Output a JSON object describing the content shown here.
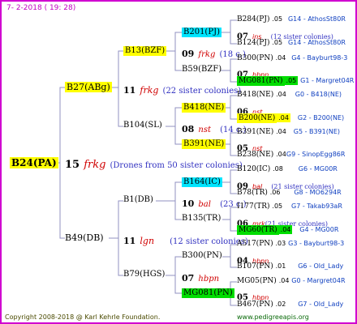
{
  "header": "7- 2-2018 ( 19: 28)",
  "footer": {
    "copyright": "Copyright 2008-2018 @ Karl Kehrle Foundation.",
    "url": "www.pedigreeapis.org"
  },
  "colors": {
    "frame": "#d000d0",
    "yellow": "#ffff00",
    "cyan": "#00e5ff",
    "green": "#00dd00",
    "nick": "#d00000",
    "sisters": "#3030c0",
    "lines": "#9090c0"
  },
  "root": {
    "label": "B24(PA)",
    "gen": "15",
    "nick": "frkg",
    "note": "(Drones from 50 sister colonies)"
  },
  "top": {
    "label": "B27(ABg)",
    "gen": "11",
    "nick": "frkg",
    "note": "(22 sister colonies)",
    "a": {
      "label": "B13(BZF)",
      "gen": "09",
      "nick": "frkg",
      "note": "(18 c.)",
      "p1": {
        "label": "B201(PJ)",
        "gen": "07",
        "nick": "ins",
        "note": "(12 sister colonies)",
        "l1": {
          "name": "B284(PJ)",
          "num": ".05",
          "loc": "G14 - AthosSt80R"
        },
        "l2": {
          "name": "B124(PJ)",
          "num": ".05",
          "loc": "G14 - AthosSt80R"
        }
      },
      "p2": {
        "label": "B59(BZF)",
        "gen": "07",
        "nick": "hbpn",
        "l1": {
          "name": "B300(PN)",
          "num": ".04",
          "loc": "G4 - Bayburt98-3"
        },
        "l2": {
          "name": "MG081(PN)",
          "num": ".05",
          "loc": "G1 - Margret04R"
        }
      }
    },
    "b": {
      "label": "B104(SL)",
      "gen": "08",
      "nick": "nst",
      "note": "(14 c.)",
      "p1": {
        "label": "B418(NE)",
        "gen": "06",
        "nick": "nst",
        "l1": {
          "name": "B418(NE)",
          "num": ".04",
          "loc": "G0 - B418(NE)"
        },
        "l2": {
          "name": "B200(NE)",
          "num": ".04",
          "loc": "G2 - B200(NE)"
        }
      },
      "p2": {
        "label": "B391(NE)",
        "gen": "05",
        "nick": "nst",
        "l1": {
          "name": "B391(NE)",
          "num": ".04",
          "loc": "G5 - B391(NE)"
        },
        "l2": {
          "name": "B238(NE)",
          "num": ".04",
          "loc": "G9 - SinopEgg86R"
        }
      }
    }
  },
  "bottom": {
    "label": "B49(DB)",
    "gen": "11",
    "nick": "lgn",
    "note": "(12 sister colonies)",
    "a": {
      "label": "B1(DB)",
      "gen": "10",
      "nick": "bal",
      "note": "(23 c.)",
      "p1": {
        "label": "B164(IC)",
        "gen": "09",
        "nick": "bal",
        "note": "(21 sister colonies)",
        "l1": {
          "name": "B120(IC)",
          "num": ".08",
          "loc": "G6 - MG00R"
        },
        "l2": {
          "name": "B78(TR)",
          "num": ".06",
          "loc": "G8 - MO6294R"
        }
      },
      "p2": {
        "label": "B135(TR)",
        "gen": "06",
        "nick": "mrk",
        "note": "(21 sister colonies)",
        "l1": {
          "name": "I177(TR)",
          "num": ".05",
          "loc": "G7 - Takab93aR"
        },
        "l2": {
          "name": "MG60(TR)",
          "num": ".04",
          "loc": "G4 - MG00R"
        }
      }
    },
    "b": {
      "label": "B79(HGS)",
      "gen": "07",
      "nick": "hbpn",
      "p1": {
        "label": "B300(PN)",
        "gen": "04",
        "nick": "hbpn",
        "l1": {
          "name": "A517(PN)",
          "num": ".03",
          "loc": "G3 - Bayburt98-3"
        },
        "l2": {
          "name": "B107(PN)",
          "num": ".01",
          "loc": "G6 - Old_Lady"
        }
      },
      "p2": {
        "label": "MG081(PN)",
        "gen": "05",
        "nick": "hbpn",
        "l1": {
          "name": "MG05(PN)",
          "num": ".04",
          "loc": "G0 - Margret04R"
        },
        "l2": {
          "name": "B467(PN)",
          "num": ".02",
          "loc": "G7 - Old_Lady"
        }
      }
    }
  }
}
